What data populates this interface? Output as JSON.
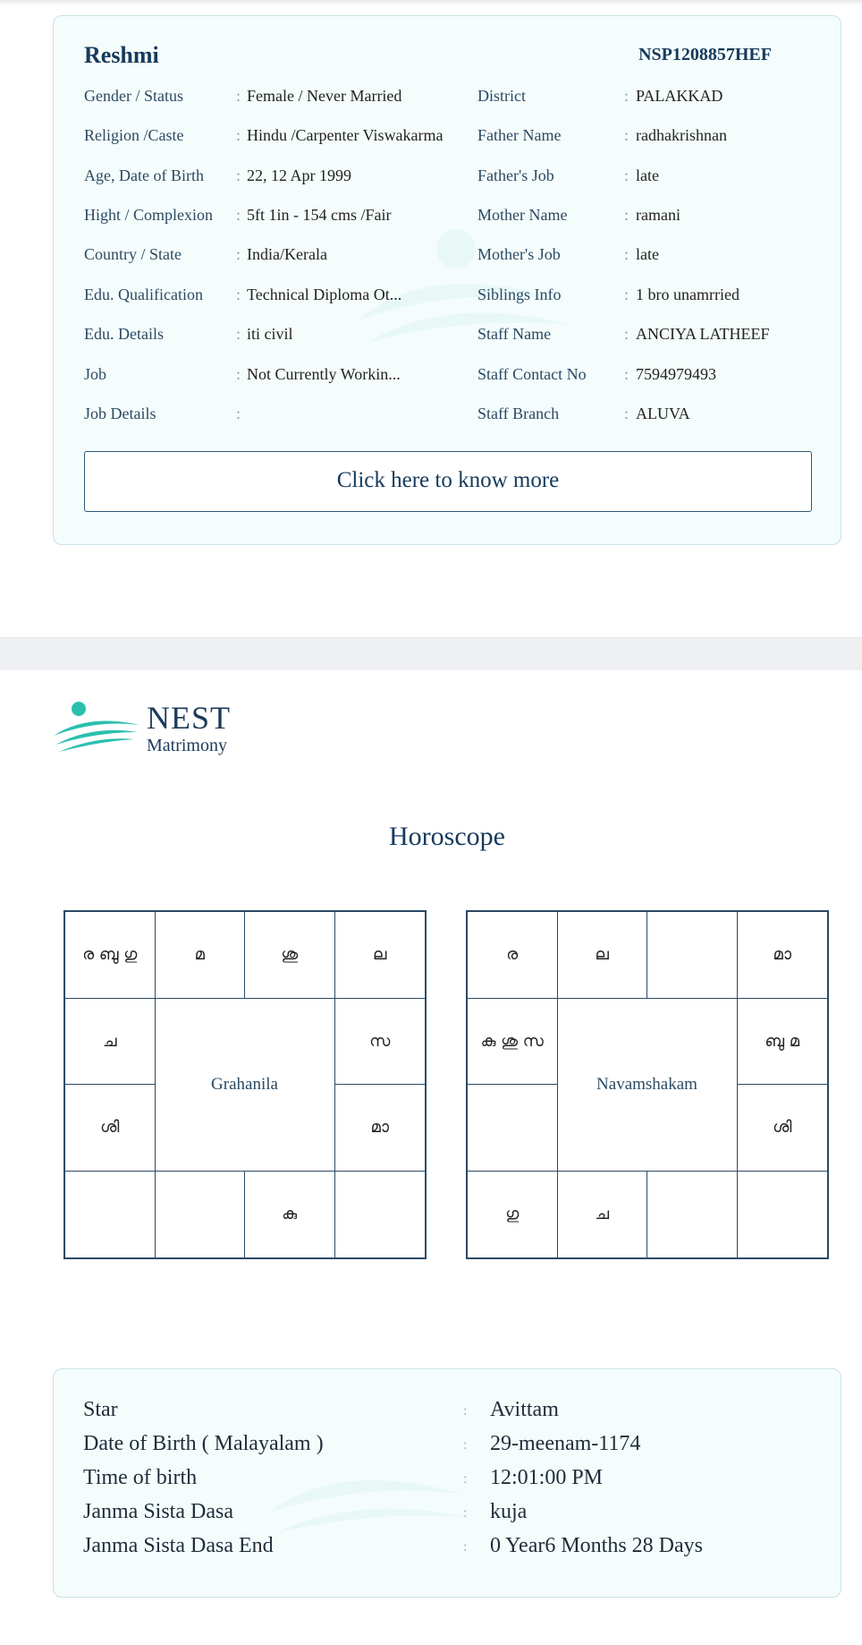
{
  "profile": {
    "name": "Reshmi",
    "id": "NSP1208857HEF",
    "left_rows": [
      {
        "label": "Gender / Status",
        "value": "Female / Never Married"
      },
      {
        "label": "Religion /Caste",
        "value": "Hindu /Carpenter Viswakarma"
      },
      {
        "label": "Age, Date of Birth",
        "value": "22, 12 Apr 1999"
      },
      {
        "label": "Hight / Complexion",
        "value": "5ft 1in - 154 cms /Fair"
      },
      {
        "label": "Country / State",
        "value": "India/Kerala"
      },
      {
        "label": "Edu. Qualification",
        "value": "Technical Diploma Ot..."
      },
      {
        "label": "Edu. Details",
        "value": "iti civil"
      },
      {
        "label": "Job",
        "value": "Not Currently Workin..."
      },
      {
        "label": "Job Details",
        "value": ""
      }
    ],
    "right_rows": [
      {
        "label": "District",
        "value": "PALAKKAD"
      },
      {
        "label": "Father Name",
        "value": "radhakrishnan"
      },
      {
        "label": "Father's Job",
        "value": "late"
      },
      {
        "label": "Mother Name",
        "value": "ramani"
      },
      {
        "label": "Mother's Job",
        "value": "late"
      },
      {
        "label": "Siblings Info",
        "value": "1 bro unamrried"
      },
      {
        "label": "Staff Name",
        "value": "ANCIYA LATHEEF"
      },
      {
        "label": "Staff Contact No",
        "value": "7594979493"
      },
      {
        "label": "Staff Branch",
        "value": "ALUVA"
      }
    ],
    "colon": ":",
    "know_more_label": "Click here to know more"
  },
  "logo": {
    "brand": "NEST",
    "sub": "Matrimony"
  },
  "horoscope": {
    "title": "Horoscope",
    "grahanila": {
      "center_label": "Grahanila",
      "cells": [
        "ര ബു ഗു",
        "മ",
        "ശു",
        "ല",
        "ച",
        "സ",
        "ശി",
        "മാ",
        "",
        "",
        "കു",
        ""
      ]
    },
    "navamshakam": {
      "center_label": "Navamshakam",
      "cells": [
        "ര",
        "ല",
        "",
        "മാ",
        "കു ശു സ",
        "ബു മ",
        "",
        "ശി",
        "ഗു",
        "ച",
        "",
        ""
      ]
    }
  },
  "details": [
    {
      "label": "Star",
      "value": "Avittam"
    },
    {
      "label": "Date of Birth ( Malayalam )",
      "value": "29-meenam-1174"
    },
    {
      "label": "Time of birth",
      "value": "12:01:00 PM"
    },
    {
      "label": "Janma Sista Dasa",
      "value": "kuja"
    },
    {
      "label": "Janma Sista Dasa End",
      "value": "0 Year6 Months 28 Days"
    }
  ],
  "colors": {
    "brand_navy": "#163a5c",
    "brand_teal": "#2bbfae",
    "card_bg": "#f5fcfc",
    "card_border": "#c9e3e6"
  }
}
